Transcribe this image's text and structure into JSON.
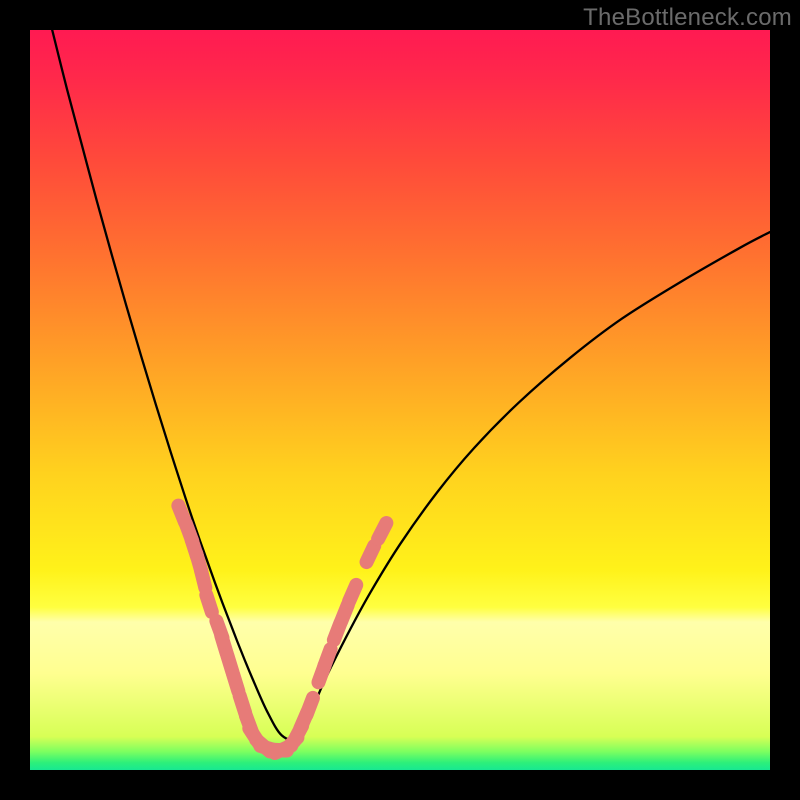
{
  "watermark": {
    "text": "TheBottleneck.com"
  },
  "colors": {
    "background": "#000000",
    "gradient_stops": [
      {
        "offset": 0.0,
        "color": "#ff1a52"
      },
      {
        "offset": 0.07,
        "color": "#ff2a4a"
      },
      {
        "offset": 0.18,
        "color": "#ff4b3a"
      },
      {
        "offset": 0.3,
        "color": "#ff7030"
      },
      {
        "offset": 0.45,
        "color": "#ffa126"
      },
      {
        "offset": 0.6,
        "color": "#ffd21e"
      },
      {
        "offset": 0.73,
        "color": "#fff21a"
      },
      {
        "offset": 0.78,
        "color": "#ffff40"
      },
      {
        "offset": 0.8,
        "color": "#ffffab"
      },
      {
        "offset": 0.87,
        "color": "#ffff90"
      },
      {
        "offset": 0.955,
        "color": "#d7ff55"
      },
      {
        "offset": 0.975,
        "color": "#7dff60"
      },
      {
        "offset": 0.99,
        "color": "#2df07a"
      },
      {
        "offset": 1.0,
        "color": "#17e892"
      }
    ],
    "curve_stroke": "#000000",
    "marker_fill": "#e77b78",
    "marker_stroke": "#e77b78"
  },
  "chart_data": {
    "type": "line",
    "title": "",
    "xlabel": "",
    "ylabel": "",
    "xlim": [
      0,
      100
    ],
    "ylim": [
      0,
      100
    ],
    "x": [
      3,
      5,
      7,
      9,
      11,
      13,
      15,
      17,
      19,
      21,
      22,
      23,
      24,
      25,
      26,
      27,
      28,
      29,
      30,
      32,
      34,
      36,
      38,
      40,
      43,
      46,
      50,
      55,
      60,
      66,
      73,
      80,
      88,
      96,
      100
    ],
    "series": [
      {
        "name": "bottleneck-curve",
        "values": [
          100,
          92,
          84.5,
          77,
          69.8,
          62.8,
          56,
          49.4,
          43,
          36.8,
          33.8,
          30.9,
          28.1,
          25.3,
          22.6,
          20.0,
          17.4,
          14.9,
          12.5,
          8.0,
          4.7,
          4.4,
          8.0,
          12.5,
          18.5,
          24.0,
          30.5,
          37.5,
          43.5,
          49.6,
          55.7,
          61.0,
          66.0,
          70.6,
          72.7
        ]
      }
    ],
    "markers": {
      "name": "scatter-accent",
      "points": [
        {
          "x": 20.5,
          "y": 34.6
        },
        {
          "x": 21.5,
          "y": 32.1
        },
        {
          "x": 22.2,
          "y": 30.0
        },
        {
          "x": 22.8,
          "y": 28.1
        },
        {
          "x": 23.4,
          "y": 25.8
        },
        {
          "x": 24.2,
          "y": 22.5
        },
        {
          "x": 25.6,
          "y": 19.0
        },
        {
          "x": 26.2,
          "y": 17.0
        },
        {
          "x": 27.0,
          "y": 14.4
        },
        {
          "x": 27.8,
          "y": 11.8
        },
        {
          "x": 28.7,
          "y": 8.9
        },
        {
          "x": 29.6,
          "y": 6.2
        },
        {
          "x": 30.3,
          "y": 4.6
        },
        {
          "x": 31.5,
          "y": 3.3
        },
        {
          "x": 32.3,
          "y": 2.9
        },
        {
          "x": 33.5,
          "y": 2.7
        },
        {
          "x": 34.2,
          "y": 2.8
        },
        {
          "x": 35.3,
          "y": 3.5
        },
        {
          "x": 36.2,
          "y": 4.9
        },
        {
          "x": 37.0,
          "y": 6.7
        },
        {
          "x": 37.8,
          "y": 8.6
        },
        {
          "x": 39.4,
          "y": 13.0
        },
        {
          "x": 40.2,
          "y": 15.2
        },
        {
          "x": 41.5,
          "y": 18.7
        },
        {
          "x": 42.5,
          "y": 21.2
        },
        {
          "x": 43.6,
          "y": 23.9
        },
        {
          "x": 46.0,
          "y": 29.2
        },
        {
          "x": 47.6,
          "y": 32.3
        }
      ]
    }
  }
}
